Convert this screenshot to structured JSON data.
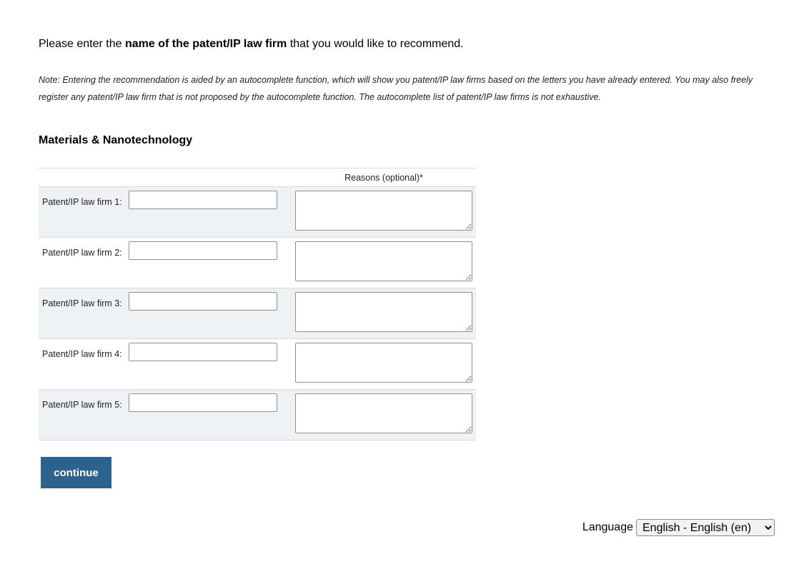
{
  "intro": {
    "before": "Please enter the ",
    "bold": "name of the patent/IP law firm",
    "after": " that you would like to recommend."
  },
  "note": "Note: Entering the recommendation is aided by an autocomplete function, which will show you patent/IP law firms based on the letters you have already entered. You may also freely register any patent/IP law firm that is not proposed by the autocomplete function. The autocomplete list of patent/IP law firms is not exhaustive.",
  "section_title": "Materials & Nanotechnology",
  "grid": {
    "reasons_header": "Reasons (optional)*",
    "rows": [
      {
        "label": "Patent/IP law firm 1:",
        "value": "",
        "reason": ""
      },
      {
        "label": "Patent/IP law firm 2:",
        "value": "",
        "reason": ""
      },
      {
        "label": "Patent/IP law firm 3:",
        "value": "",
        "reason": ""
      },
      {
        "label": "Patent/IP law firm 4:",
        "value": "",
        "reason": ""
      },
      {
        "label": "Patent/IP law firm 5:",
        "value": "",
        "reason": ""
      }
    ]
  },
  "continue_label": "continue",
  "language": {
    "label": "Language",
    "selected": "English - English (en)"
  },
  "colors": {
    "button_bg": "#2b628e",
    "row_shade": "#eff2f5"
  }
}
